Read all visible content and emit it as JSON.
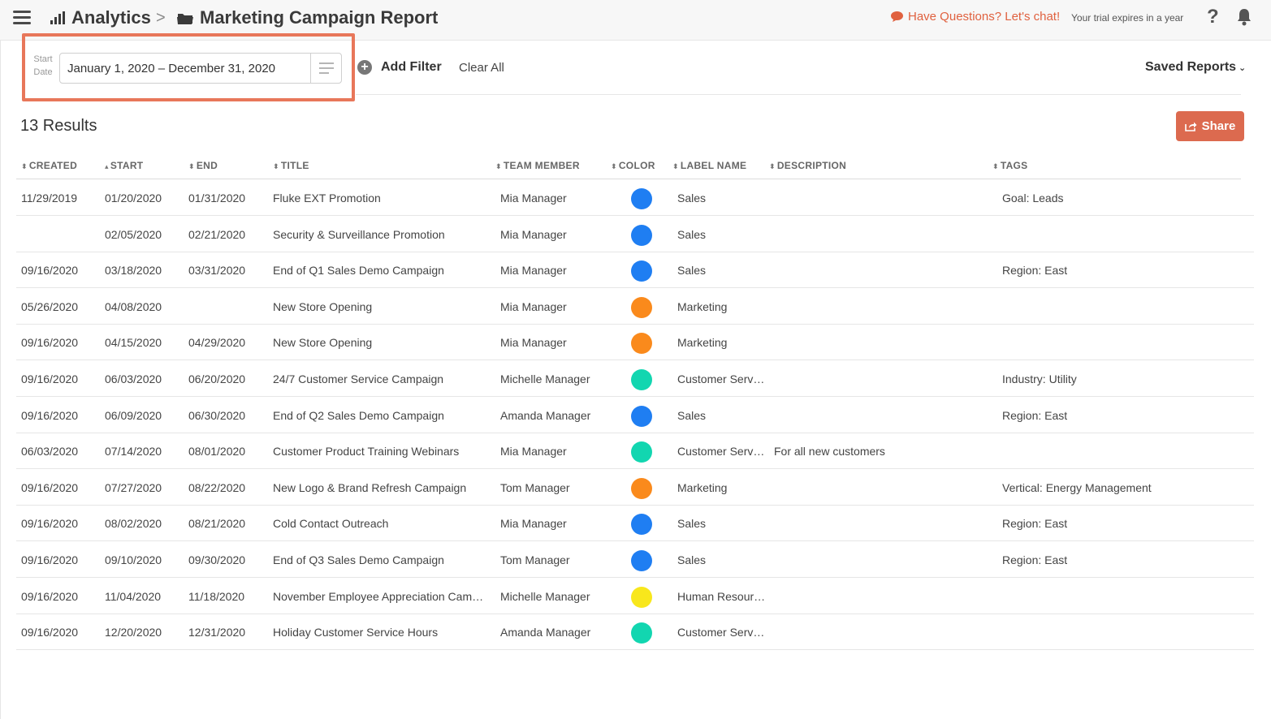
{
  "header": {
    "breadcrumb_root": "Analytics",
    "breadcrumb_separator": ">",
    "breadcrumb_current": "Marketing Campaign Report",
    "chat_text": "Have Questions? Let's chat!",
    "trial_text": "Your trial expires in a year",
    "help_label": "?"
  },
  "filters": {
    "start_label_line1": "Start",
    "start_label_line2": "Date",
    "date_range": "January 1, 2020  –  December 31, 2020",
    "add_filter_label": "Add Filter",
    "clear_all_label": "Clear All",
    "saved_reports_label": "Saved Reports",
    "highlight_color": "#e8775a"
  },
  "results": {
    "count_label": "13 Results",
    "share_label": "Share",
    "share_color": "#dc6a4f"
  },
  "table": {
    "columns": [
      {
        "key": "created",
        "label": "CREATED",
        "arrow": "⬍"
      },
      {
        "key": "start",
        "label": "START",
        "arrow": "▴"
      },
      {
        "key": "end",
        "label": "END",
        "arrow": "⬍"
      },
      {
        "key": "title",
        "label": "TITLE",
        "arrow": "⬍"
      },
      {
        "key": "team_member",
        "label": "TEAM MEMBER",
        "arrow": "⬍"
      },
      {
        "key": "color",
        "label": "COLOR",
        "arrow": "⬍"
      },
      {
        "key": "label_name",
        "label": "LABEL NAME",
        "arrow": "⬍"
      },
      {
        "key": "description",
        "label": "DESCRIPTION",
        "arrow": "⬍"
      },
      {
        "key": "tags",
        "label": "TAGS",
        "arrow": "⬍"
      }
    ],
    "colors": {
      "blue": "#1f7ef2",
      "orange": "#fa8a1c",
      "teal": "#12d6b0",
      "yellow": "#f8e71c"
    },
    "rows": [
      {
        "created": "11/29/2019",
        "start": "01/20/2020",
        "end": "01/31/2020",
        "title": "Fluke EXT Promotion",
        "team_member": "Mia Manager",
        "color": "blue",
        "label_name": "Sales",
        "description": "",
        "tags": "Goal: Leads"
      },
      {
        "created": "",
        "start": "02/05/2020",
        "end": "02/21/2020",
        "title": "Security & Surveillance Promotion",
        "team_member": "Mia Manager",
        "color": "blue",
        "label_name": "Sales",
        "description": "",
        "tags": ""
      },
      {
        "created": "09/16/2020",
        "start": "03/18/2020",
        "end": "03/31/2020",
        "title": "End of Q1 Sales Demo Campaign",
        "team_member": "Mia Manager",
        "color": "blue",
        "label_name": "Sales",
        "description": "",
        "tags": "Region: East"
      },
      {
        "created": "05/26/2020",
        "start": "04/08/2020",
        "end": "",
        "title": "New Store Opening",
        "team_member": "Mia Manager",
        "color": "orange",
        "label_name": "Marketing",
        "description": "",
        "tags": ""
      },
      {
        "created": "09/16/2020",
        "start": "04/15/2020",
        "end": "04/29/2020",
        "title": "New Store Opening",
        "team_member": "Mia Manager",
        "color": "orange",
        "label_name": "Marketing",
        "description": "",
        "tags": ""
      },
      {
        "created": "09/16/2020",
        "start": "06/03/2020",
        "end": "06/20/2020",
        "title": "24/7 Customer Service Campaign",
        "team_member": "Michelle Manager",
        "color": "teal",
        "label_name": "Customer Serv…",
        "description": "",
        "tags": "Industry: Utility"
      },
      {
        "created": "09/16/2020",
        "start": "06/09/2020",
        "end": "06/30/2020",
        "title": "End of Q2 Sales Demo Campaign",
        "team_member": "Amanda Manager",
        "color": "blue",
        "label_name": "Sales",
        "description": "",
        "tags": "Region: East"
      },
      {
        "created": "06/03/2020",
        "start": "07/14/2020",
        "end": "08/01/2020",
        "title": "Customer Product Training Webinars",
        "team_member": "Mia Manager",
        "color": "teal",
        "label_name": "Customer Serv…",
        "description": "For all new customers",
        "tags": ""
      },
      {
        "created": "09/16/2020",
        "start": "07/27/2020",
        "end": "08/22/2020",
        "title": "New Logo & Brand Refresh Campaign",
        "team_member": "Tom Manager",
        "color": "orange",
        "label_name": "Marketing",
        "description": "",
        "tags": "Vertical: Energy Management"
      },
      {
        "created": "09/16/2020",
        "start": "08/02/2020",
        "end": "08/21/2020",
        "title": "Cold Contact Outreach",
        "team_member": "Mia Manager",
        "color": "blue",
        "label_name": "Sales",
        "description": "",
        "tags": "Region: East"
      },
      {
        "created": "09/16/2020",
        "start": "09/10/2020",
        "end": "09/30/2020",
        "title": "End of Q3 Sales Demo Campaign",
        "team_member": "Tom Manager",
        "color": "blue",
        "label_name": "Sales",
        "description": "",
        "tags": "Region: East"
      },
      {
        "created": "09/16/2020",
        "start": "11/04/2020",
        "end": "11/18/2020",
        "title": "November Employee Appreciation Cam…",
        "team_member": "Michelle Manager",
        "color": "yellow",
        "label_name": "Human Resour…",
        "description": "",
        "tags": ""
      },
      {
        "created": "09/16/2020",
        "start": "12/20/2020",
        "end": "12/31/2020",
        "title": "Holiday Customer Service Hours",
        "team_member": "Amanda Manager",
        "color": "teal",
        "label_name": "Customer Serv…",
        "description": "",
        "tags": ""
      }
    ]
  }
}
